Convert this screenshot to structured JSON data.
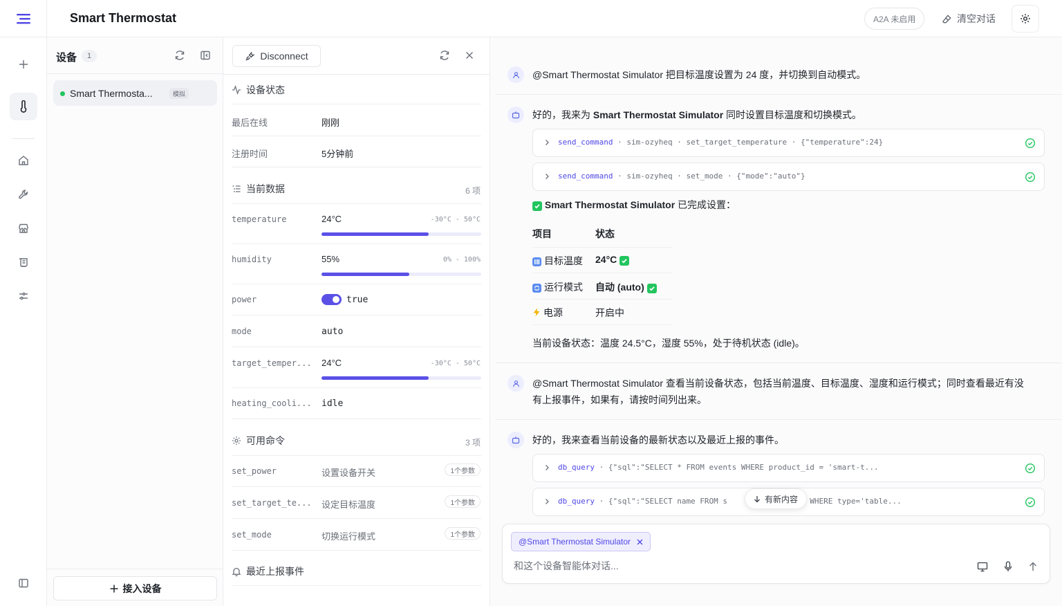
{
  "app": {
    "title": "Smart Thermostat"
  },
  "topbar": {
    "a2a_label": "A2A 未启用",
    "clear_label": "清空对话"
  },
  "devices": {
    "title": "设备",
    "count": "1",
    "items": [
      {
        "name": "Smart Thermosta...",
        "tag": "模拟",
        "status_color": "#22c55e"
      }
    ],
    "connect_label": "接入设备"
  },
  "detail": {
    "disconnect_label": "Disconnect",
    "status_section": {
      "title": "设备状态"
    },
    "meta": [
      {
        "label": "最后在线",
        "value": "刚刚"
      },
      {
        "label": "注册时间",
        "value": "5分钟前"
      }
    ],
    "data_section": {
      "title": "当前数据",
      "count": "6 项"
    },
    "data": [
      {
        "key": "temperature",
        "value": "24°C",
        "range": "-30°C - 50°C",
        "level": 0.67
      },
      {
        "key": "humidity",
        "value": "55%",
        "range": "0% - 100%",
        "level": 0.55
      },
      {
        "key": "power",
        "value": "true",
        "on": true
      },
      {
        "key": "mode",
        "value": "auto"
      },
      {
        "key": "target_temper...",
        "value": "24°C",
        "range": "-30°C - 50°C",
        "level": 0.67
      },
      {
        "key": "heating_cooli...",
        "value": "idle"
      }
    ],
    "commands_section": {
      "title": "可用命令",
      "count": "3 项"
    },
    "commands": [
      {
        "name": "set_power",
        "desc": "设置设备开关",
        "params": "1个参数"
      },
      {
        "name": "set_target_te...",
        "desc": "设定目标温度",
        "params": "1个参数"
      },
      {
        "name": "set_mode",
        "desc": "切换运行模式",
        "params": "1个参数"
      }
    ],
    "events_section": {
      "title": "最近上报事件"
    }
  },
  "chat": {
    "messages": [
      {
        "role": "user",
        "text": "@Smart Thermostat Simulator 把目标温度设置为 24 度，并切换到自动模式。"
      },
      {
        "role": "assistant",
        "intro_pre": "好的，我来为 ",
        "intro_bold": "Smart Thermostat Simulator",
        "intro_post": " 同时设置目标温度和切换模式。",
        "tools": [
          {
            "fn": "send_command",
            "args": "· sim-ozyheq · set_target_temperature · {\"temperature\":24}"
          },
          {
            "fn": "send_command",
            "args": "· sim-ozyheq · set_mode · {\"mode\":\"auto\"}"
          }
        ],
        "done_bold": "Smart Thermostat Simulator",
        "done_post": " 已完成设置：",
        "table": {
          "headers": [
            "项目",
            "状态"
          ],
          "rows": [
            {
              "item": "目标温度",
              "status": "24°C"
            },
            {
              "item": "运行模式",
              "status": "自动 (auto)"
            },
            {
              "item": "电源",
              "status": "开启中"
            }
          ]
        },
        "summary": "当前设备状态：温度 24.5°C，湿度 55%，处于待机状态 (idle)。"
      },
      {
        "role": "user",
        "line1": "@Smart Thermostat Simulator 查看当前设备状态，包括当前温度、目标温度、湿度和运行模式；同时查看最近有没",
        "line2": "有上报事件，如果有，请按时间列出来。"
      },
      {
        "role": "assistant",
        "intro": "好的，我来查看当前设备的最新状态以及最近上报的事件。",
        "tools": [
          {
            "fn": "db_query",
            "args": "· {\"sql\":\"SELECT * FROM events WHERE product_id = 'smart-t..."
          },
          {
            "fn": "db_query",
            "args": "· {\"sql\":\"SELECT name FROM s                  WHERE type='table..."
          }
        ]
      }
    ],
    "new_content_label": "有新内容",
    "composer": {
      "mention": "@Smart Thermostat Simulator",
      "placeholder": "和这个设备智能体对话..."
    }
  },
  "colors": {
    "accent": "#5b50e6",
    "success": "#22c55e",
    "link": "#4f46e5"
  },
  "icons": [
    "menu-icon",
    "plus-icon",
    "thermometer-icon",
    "home-icon",
    "wrench-icon",
    "store-icon",
    "scroll-icon",
    "sliders-icon",
    "sidebar-toggle-icon",
    "refresh-icon",
    "panel-collapse-icon",
    "unplug-icon",
    "close-icon",
    "activity-icon",
    "list-icon",
    "gear-icon",
    "bell-icon",
    "eraser-icon",
    "user-icon",
    "bot-icon",
    "chevron-right-icon",
    "check-circle-icon",
    "monitor-icon",
    "mic-icon",
    "send-arrow-icon",
    "arrow-down-icon"
  ]
}
